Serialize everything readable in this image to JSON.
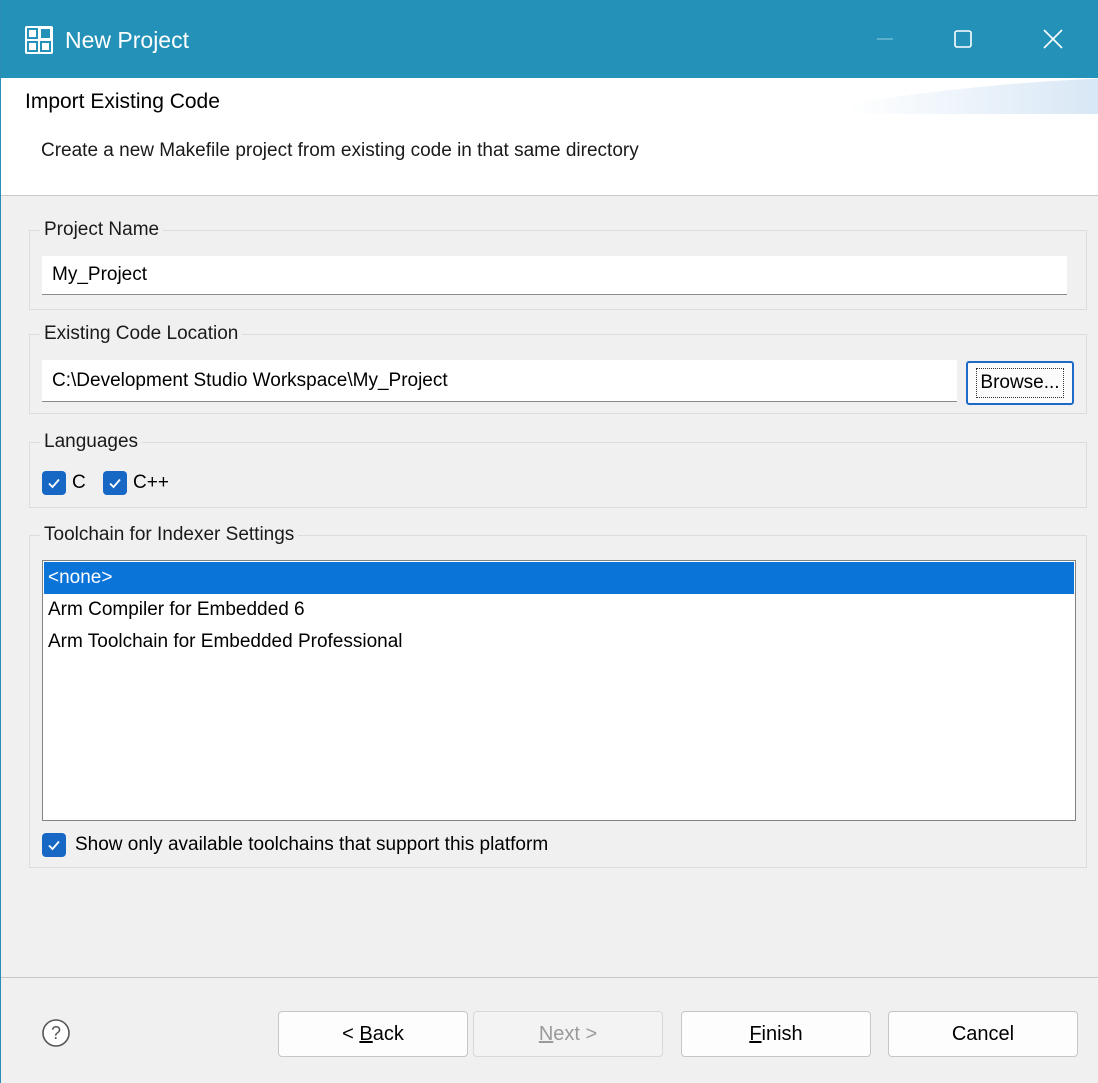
{
  "window": {
    "title": "New Project",
    "app_icon": "app-grid-icon",
    "controls": [
      "minimize-icon",
      "maximize-icon",
      "close-icon"
    ]
  },
  "header": {
    "title": "Import Existing Code",
    "description": "Create a new Makefile project from existing code in that same directory"
  },
  "project_name": {
    "label": "Project Name",
    "value": "My_Project"
  },
  "code_location": {
    "label": "Existing Code Location",
    "value": "C:\\Development Studio Workspace\\My_Project",
    "browse_label": "Browse..."
  },
  "languages": {
    "label": "Languages",
    "options": [
      {
        "label": "C",
        "checked": true
      },
      {
        "label": "C++",
        "checked": true
      }
    ]
  },
  "toolchain": {
    "label": "Toolchain for Indexer Settings",
    "items": [
      {
        "label": "<none>",
        "selected": true
      },
      {
        "label": "Arm Compiler for Embedded 6",
        "selected": false
      },
      {
        "label": "Arm Toolchain for Embedded Professional",
        "selected": false
      }
    ],
    "show_only_available": {
      "label": "Show only available toolchains that support this platform",
      "checked": true
    }
  },
  "footer": {
    "help_icon": "help-circle-icon",
    "back": {
      "mnemonic": "B",
      "rest": "ack",
      "prefix": "< ",
      "enabled": true
    },
    "next": {
      "mnemonic": "N",
      "rest": "ext >",
      "prefix": "",
      "enabled": false
    },
    "finish": {
      "mnemonic": "F",
      "rest": "inish",
      "prefix": "",
      "enabled": true
    },
    "cancel": {
      "label": "Cancel",
      "enabled": true
    }
  },
  "colors": {
    "titlebar": "#2391b8",
    "accent": "#1668c4",
    "selection": "#0a74d9"
  }
}
